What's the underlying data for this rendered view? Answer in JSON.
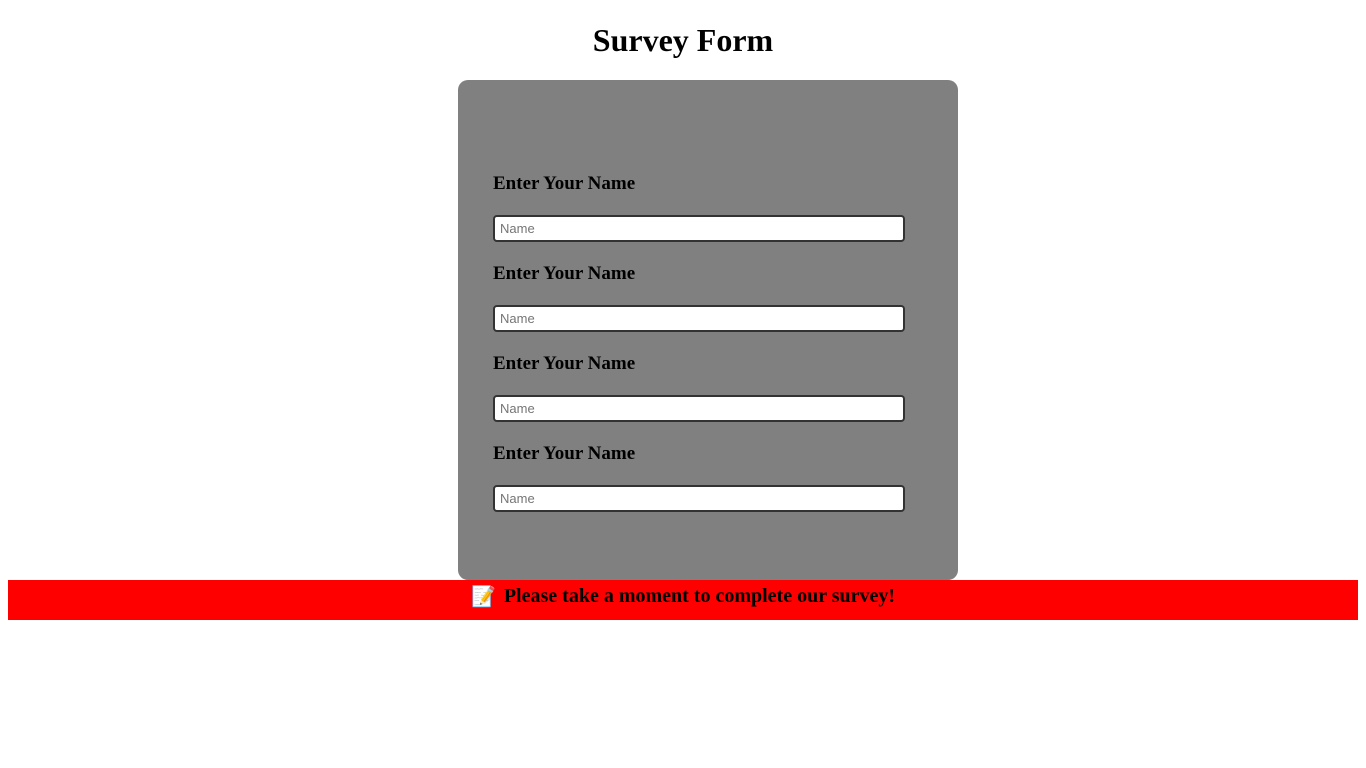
{
  "page": {
    "title": "Survey Form"
  },
  "form": {
    "background_color": "#808080",
    "fields": [
      {
        "label": "Enter Your Name",
        "placeholder": "Name",
        "value": ""
      },
      {
        "label": "Enter Your Name",
        "placeholder": "Name",
        "value": ""
      },
      {
        "label": "Enter Your Name",
        "placeholder": "Name",
        "value": ""
      },
      {
        "label": "Enter Your Name",
        "placeholder": "Name",
        "value": ""
      }
    ]
  },
  "banner": {
    "background_color": "#ff0000",
    "icon": "memo-icon",
    "icon_glyph": "📝",
    "text": "Please take a moment to complete our survey!"
  }
}
